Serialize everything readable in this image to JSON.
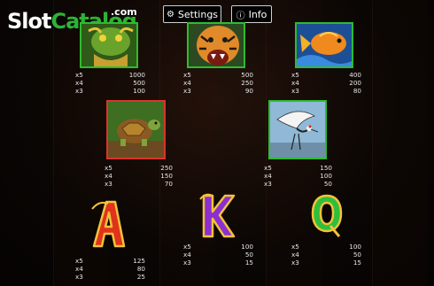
{
  "logo": {
    "part1": "Slot",
    "part2": "Catalog",
    "suffix": ".com"
  },
  "header": {
    "settings_label": "Settings",
    "info_label": "Info"
  },
  "symbols": [
    {
      "name": "dragon",
      "pays": [
        {
          "k": "x5",
          "v": "1000"
        },
        {
          "k": "x4",
          "v": "500"
        },
        {
          "k": "x3",
          "v": "100"
        }
      ]
    },
    {
      "name": "tiger",
      "pays": [
        {
          "k": "x5",
          "v": "500"
        },
        {
          "k": "x4",
          "v": "250"
        },
        {
          "k": "x3",
          "v": "90"
        }
      ]
    },
    {
      "name": "koi",
      "pays": [
        {
          "k": "x5",
          "v": "400"
        },
        {
          "k": "x4",
          "v": "200"
        },
        {
          "k": "x3",
          "v": "80"
        }
      ]
    },
    {
      "name": "turtle",
      "pays": [
        {
          "k": "x5",
          "v": "250"
        },
        {
          "k": "x4",
          "v": "150"
        },
        {
          "k": "x3",
          "v": "70"
        }
      ]
    },
    {
      "name": "crane",
      "pays": [
        {
          "k": "x5",
          "v": "150"
        },
        {
          "k": "x4",
          "v": "100"
        },
        {
          "k": "x3",
          "v": "50"
        }
      ]
    },
    {
      "name": "A",
      "pays": [
        {
          "k": "x5",
          "v": "125"
        },
        {
          "k": "x4",
          "v": "80"
        },
        {
          "k": "x3",
          "v": "25"
        }
      ]
    },
    {
      "name": "K",
      "pays": [
        {
          "k": "x5",
          "v": "100"
        },
        {
          "k": "x4",
          "v": "50"
        },
        {
          "k": "x3",
          "v": "15"
        }
      ]
    },
    {
      "name": "Q",
      "pays": [
        {
          "k": "x5",
          "v": "100"
        },
        {
          "k": "x4",
          "v": "50"
        },
        {
          "k": "x3",
          "v": "15"
        }
      ]
    }
  ],
  "colors": {
    "logo_green": "#2db334",
    "frame_green": "#2fbb2f",
    "frame_red": "#d9352a"
  }
}
